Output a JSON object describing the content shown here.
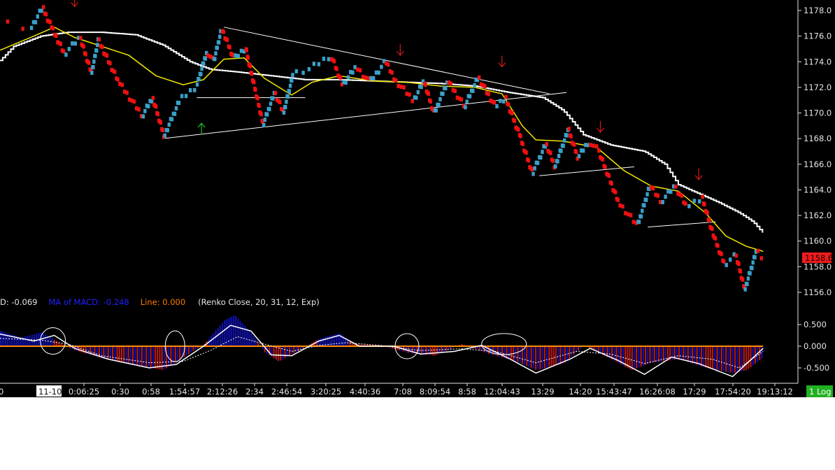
{
  "price_axis": {
    "ticks": [
      "1178.0",
      "1176.0",
      "1174.0",
      "1172.0",
      "1170.0",
      "1168.0",
      "1166.0",
      "1164.0",
      "1162.0",
      "1160.0",
      "1158.0",
      "1156.0"
    ],
    "current_price_label": "1158.6",
    "current_price_color": "#ee1c1c"
  },
  "macd_axis": {
    "ticks": [
      "0.500",
      "0.000",
      "-0.500"
    ]
  },
  "macd_header": {
    "macd_prefix": "D: ",
    "macd_value": "-0.069",
    "ma_label": "MA of MACD: ",
    "ma_value": "-0.248",
    "line_label": "Line: ",
    "line_value": "0.000",
    "params": "(Renko Close, 20, 31, 12, Exp)"
  },
  "time_axis": {
    "date_label": "11-10",
    "ticks": [
      "0:06:25",
      "0:30",
      "0:58",
      "1:54:57",
      "2:12:26",
      "2:34",
      "2:46:54",
      "3:20:25",
      "4:40:36",
      "7:08",
      "8:09:54",
      "8:58",
      "12:04:43",
      "13:29",
      "14:20",
      "15:43:47",
      "16:26:08",
      "17:29",
      "17:54:20",
      "19:13:12"
    ]
  },
  "log_button": {
    "label": "1 Log"
  },
  "colors": {
    "down_brick": "#ee1111",
    "up_brick": "#3aa0c8",
    "ma_fast": "#f2e600",
    "ma_slow": "#ffffff",
    "macd_positive": "#1010b0",
    "macd_negative": "#b01818",
    "signal_line": "#ff8a00",
    "arrow_down": "#d81818",
    "arrow_up": "#22bb22"
  },
  "chart_data": {
    "type": "line",
    "title": "",
    "y_range": [
      1155.2,
      1179.3
    ],
    "macd_range": [
      -0.72,
      0.62
    ],
    "price_path": [
      {
        "t": 0.0,
        "p": 1177.2
      },
      {
        "t": 0.045,
        "p": 1176.6
      },
      {
        "t": 0.063,
        "p": 1178.2
      },
      {
        "t": 0.075,
        "p": 1176.8
      },
      {
        "t": 0.095,
        "p": 1174.6
      },
      {
        "t": 0.118,
        "p": 1175.9
      },
      {
        "t": 0.135,
        "p": 1173.1
      },
      {
        "t": 0.145,
        "p": 1175.7
      },
      {
        "t": 0.175,
        "p": 1172.4
      },
      {
        "t": 0.21,
        "p": 1169.8
      },
      {
        "t": 0.225,
        "p": 1171.2
      },
      {
        "t": 0.242,
        "p": 1168.2
      },
      {
        "t": 0.265,
        "p": 1171.0
      },
      {
        "t": 0.29,
        "p": 1172.1
      },
      {
        "t": 0.305,
        "p": 1174.8
      },
      {
        "t": 0.315,
        "p": 1174.0
      },
      {
        "t": 0.327,
        "p": 1176.6
      },
      {
        "t": 0.345,
        "p": 1174.2
      },
      {
        "t": 0.362,
        "p": 1175.1
      },
      {
        "t": 0.388,
        "p": 1169.1
      },
      {
        "t": 0.405,
        "p": 1171.6
      },
      {
        "t": 0.418,
        "p": 1170.0
      },
      {
        "t": 0.432,
        "p": 1173.0
      },
      {
        "t": 0.452,
        "p": 1173.3
      },
      {
        "t": 0.488,
        "p": 1174.5
      },
      {
        "t": 0.505,
        "p": 1172.2
      },
      {
        "t": 0.525,
        "p": 1173.6
      },
      {
        "t": 0.545,
        "p": 1172.4
      },
      {
        "t": 0.568,
        "p": 1174.0
      },
      {
        "t": 0.585,
        "p": 1172.4
      },
      {
        "t": 0.61,
        "p": 1171.0
      },
      {
        "t": 0.625,
        "p": 1172.5
      },
      {
        "t": 0.64,
        "p": 1169.9
      },
      {
        "t": 0.66,
        "p": 1172.5
      },
      {
        "t": 0.685,
        "p": 1170.5
      },
      {
        "t": 0.705,
        "p": 1172.8
      },
      {
        "t": 0.73,
        "p": 1170.5
      },
      {
        "t": 0.745,
        "p": 1171.2
      },
      {
        "t": 0.765,
        "p": 1168.4
      },
      {
        "t": 0.785,
        "p": 1165.3
      },
      {
        "t": 0.805,
        "p": 1167.6
      },
      {
        "t": 0.818,
        "p": 1165.8
      },
      {
        "t": 0.838,
        "p": 1168.7
      },
      {
        "t": 0.852,
        "p": 1166.5
      },
      {
        "t": 0.868,
        "p": 1167.8
      },
      {
        "t": 0.882,
        "p": 1167.1
      },
      {
        "t": 0.912,
        "p": 1163.0
      },
      {
        "t": 0.94,
        "p": 1161.2
      },
      {
        "t": 0.958,
        "p": 1164.3
      },
      {
        "t": 0.975,
        "p": 1163.1
      },
      {
        "t": 0.995,
        "p": 1164.3
      },
      {
        "t": 1.012,
        "p": 1162.7
      },
      {
        "t": 1.035,
        "p": 1163.4
      },
      {
        "t": 1.052,
        "p": 1160.4
      },
      {
        "t": 1.068,
        "p": 1158.2
      },
      {
        "t": 1.085,
        "p": 1158.9
      },
      {
        "t": 1.098,
        "p": 1156.2
      },
      {
        "t": 1.115,
        "p": 1159.2
      },
      {
        "t": 1.125,
        "p": 1158.6
      }
    ],
    "ma_fast": [
      {
        "t": 0.0,
        "p": 1174.9
      },
      {
        "t": 0.05,
        "p": 1176.0
      },
      {
        "t": 0.08,
        "p": 1176.7
      },
      {
        "t": 0.11,
        "p": 1175.9
      },
      {
        "t": 0.15,
        "p": 1175.2
      },
      {
        "t": 0.19,
        "p": 1174.5
      },
      {
        "t": 0.23,
        "p": 1172.9
      },
      {
        "t": 0.27,
        "p": 1172.2
      },
      {
        "t": 0.3,
        "p": 1172.6
      },
      {
        "t": 0.33,
        "p": 1174.2
      },
      {
        "t": 0.36,
        "p": 1174.3
      },
      {
        "t": 0.39,
        "p": 1172.7
      },
      {
        "t": 0.43,
        "p": 1171.4
      },
      {
        "t": 0.46,
        "p": 1172.4
      },
      {
        "t": 0.5,
        "p": 1172.9
      },
      {
        "t": 0.55,
        "p": 1172.5
      },
      {
        "t": 0.6,
        "p": 1172.4
      },
      {
        "t": 0.65,
        "p": 1172.1
      },
      {
        "t": 0.7,
        "p": 1172.0
      },
      {
        "t": 0.74,
        "p": 1171.5
      },
      {
        "t": 0.77,
        "p": 1169.0
      },
      {
        "t": 0.79,
        "p": 1167.9
      },
      {
        "t": 0.83,
        "p": 1167.8
      },
      {
        "t": 0.88,
        "p": 1167.3
      },
      {
        "t": 0.92,
        "p": 1165.5
      },
      {
        "t": 0.96,
        "p": 1164.3
      },
      {
        "t": 1.0,
        "p": 1163.9
      },
      {
        "t": 1.04,
        "p": 1162.2
      },
      {
        "t": 1.07,
        "p": 1160.4
      },
      {
        "t": 1.1,
        "p": 1159.6
      },
      {
        "t": 1.125,
        "p": 1159.2
      }
    ],
    "ma_slow": [
      {
        "t": 0.0,
        "p": 1174.1
      },
      {
        "t": 0.02,
        "p": 1175.2
      },
      {
        "t": 0.06,
        "p": 1176.0
      },
      {
        "t": 0.1,
        "p": 1176.3
      },
      {
        "t": 0.15,
        "p": 1176.3
      },
      {
        "t": 0.2,
        "p": 1176.1
      },
      {
        "t": 0.24,
        "p": 1175.3
      },
      {
        "t": 0.28,
        "p": 1174.0
      },
      {
        "t": 0.31,
        "p": 1173.4
      },
      {
        "t": 0.35,
        "p": 1173.2
      },
      {
        "t": 0.4,
        "p": 1172.9
      },
      {
        "t": 0.45,
        "p": 1172.6
      },
      {
        "t": 0.5,
        "p": 1172.6
      },
      {
        "t": 0.55,
        "p": 1172.5
      },
      {
        "t": 0.6,
        "p": 1172.4
      },
      {
        "t": 0.65,
        "p": 1172.3
      },
      {
        "t": 0.7,
        "p": 1172.1
      },
      {
        "t": 0.75,
        "p": 1171.6
      },
      {
        "t": 0.8,
        "p": 1171.2
      },
      {
        "t": 0.83,
        "p": 1170.2
      },
      {
        "t": 0.86,
        "p": 1168.3
      },
      {
        "t": 0.9,
        "p": 1167.5
      },
      {
        "t": 0.95,
        "p": 1167.0
      },
      {
        "t": 0.98,
        "p": 1166.0
      },
      {
        "t": 1.0,
        "p": 1164.4
      },
      {
        "t": 1.03,
        "p": 1163.7
      },
      {
        "t": 1.06,
        "p": 1163.0
      },
      {
        "t": 1.09,
        "p": 1162.2
      },
      {
        "t": 1.11,
        "p": 1161.5
      },
      {
        "t": 1.125,
        "p": 1160.6
      }
    ],
    "trendlines": [
      {
        "t1": 0.33,
        "p1": 1176.7,
        "t2": 0.81,
        "p2": 1171.5
      },
      {
        "t1": 0.24,
        "p1": 1168.0,
        "t2": 0.835,
        "p2": 1171.6
      },
      {
        "t1": 0.29,
        "p1": 1171.2,
        "t2": 0.45,
        "p2": 1171.2
      },
      {
        "t1": 0.795,
        "p1": 1165.1,
        "t2": 0.935,
        "p2": 1165.8
      },
      {
        "t1": 0.955,
        "p1": 1161.1,
        "t2": 1.055,
        "p2": 1161.5
      }
    ],
    "signal_arrows": [
      {
        "type": "down",
        "t": 0.11,
        "p": 1178.3
      },
      {
        "type": "down",
        "t": 0.59,
        "p": 1174.5
      },
      {
        "type": "down",
        "t": 0.74,
        "p": 1173.6
      },
      {
        "type": "down",
        "t": 0.885,
        "p": 1168.5
      },
      {
        "type": "down",
        "t": 1.03,
        "p": 1164.8
      },
      {
        "type": "up",
        "t": 0.297,
        "p": 1169.2
      }
    ],
    "macd_hist": [
      {
        "t": 0.0,
        "v": 0.35
      },
      {
        "t": 0.03,
        "v": 0.2
      },
      {
        "t": 0.06,
        "v": 0.32
      },
      {
        "t": 0.09,
        "v": 0.05
      },
      {
        "t": 0.11,
        "v": -0.1
      },
      {
        "t": 0.15,
        "v": -0.28
      },
      {
        "t": 0.2,
        "v": -0.45
      },
      {
        "t": 0.24,
        "v": -0.55
      },
      {
        "t": 0.27,
        "v": -0.25
      },
      {
        "t": 0.3,
        "v": 0.05
      },
      {
        "t": 0.33,
        "v": 0.6
      },
      {
        "t": 0.345,
        "v": 0.72
      },
      {
        "t": 0.37,
        "v": 0.3
      },
      {
        "t": 0.39,
        "v": -0.15
      },
      {
        "t": 0.41,
        "v": -0.35
      },
      {
        "t": 0.44,
        "v": -0.1
      },
      {
        "t": 0.47,
        "v": 0.18
      },
      {
        "t": 0.5,
        "v": 0.3
      },
      {
        "t": 0.52,
        "v": 0.05
      },
      {
        "t": 0.56,
        "v": 0.02
      },
      {
        "t": 0.6,
        "v": -0.15
      },
      {
        "t": 0.64,
        "v": -0.22
      },
      {
        "t": 0.68,
        "v": 0.05
      },
      {
        "t": 0.72,
        "v": -0.18
      },
      {
        "t": 0.76,
        "v": -0.35
      },
      {
        "t": 0.79,
        "v": -0.55
      },
      {
        "t": 0.83,
        "v": -0.4
      },
      {
        "t": 0.86,
        "v": 0.02
      },
      {
        "t": 0.9,
        "v": -0.3
      },
      {
        "t": 0.93,
        "v": -0.55
      },
      {
        "t": 0.96,
        "v": -0.38
      },
      {
        "t": 1.0,
        "v": -0.3
      },
      {
        "t": 1.04,
        "v": -0.5
      },
      {
        "t": 1.08,
        "v": -0.62
      },
      {
        "t": 1.1,
        "v": -0.55
      },
      {
        "t": 1.125,
        "v": -0.25
      }
    ],
    "macd_line": [
      {
        "t": 0.0,
        "v": 0.28
      },
      {
        "t": 0.05,
        "v": 0.12
      },
      {
        "t": 0.08,
        "v": 0.25
      },
      {
        "t": 0.11,
        "v": -0.05
      },
      {
        "t": 0.16,
        "v": -0.3
      },
      {
        "t": 0.22,
        "v": -0.5
      },
      {
        "t": 0.26,
        "v": -0.42
      },
      {
        "t": 0.3,
        "v": 0.0
      },
      {
        "t": 0.34,
        "v": 0.48
      },
      {
        "t": 0.37,
        "v": 0.35
      },
      {
        "t": 0.4,
        "v": -0.2
      },
      {
        "t": 0.43,
        "v": -0.22
      },
      {
        "t": 0.47,
        "v": 0.12
      },
      {
        "t": 0.5,
        "v": 0.25
      },
      {
        "t": 0.53,
        "v": 0.0
      },
      {
        "t": 0.58,
        "v": 0.0
      },
      {
        "t": 0.62,
        "v": -0.18
      },
      {
        "t": 0.67,
        "v": -0.12
      },
      {
        "t": 0.71,
        "v": 0.02
      },
      {
        "t": 0.75,
        "v": -0.28
      },
      {
        "t": 0.79,
        "v": -0.62
      },
      {
        "t": 0.84,
        "v": -0.3
      },
      {
        "t": 0.87,
        "v": -0.05
      },
      {
        "t": 0.91,
        "v": -0.32
      },
      {
        "t": 0.95,
        "v": -0.65
      },
      {
        "t": 0.99,
        "v": -0.25
      },
      {
        "t": 1.03,
        "v": -0.4
      },
      {
        "t": 1.08,
        "v": -0.7
      },
      {
        "t": 1.125,
        "v": -0.05
      }
    ],
    "macd_ma": [
      {
        "t": 0.0,
        "v": 0.18
      },
      {
        "t": 0.06,
        "v": 0.14
      },
      {
        "t": 0.1,
        "v": 0.05
      },
      {
        "t": 0.15,
        "v": -0.22
      },
      {
        "t": 0.22,
        "v": -0.38
      },
      {
        "t": 0.27,
        "v": -0.35
      },
      {
        "t": 0.31,
        "v": -0.1
      },
      {
        "t": 0.35,
        "v": 0.22
      },
      {
        "t": 0.39,
        "v": 0.05
      },
      {
        "t": 0.43,
        "v": -0.12
      },
      {
        "t": 0.47,
        "v": 0.02
      },
      {
        "t": 0.51,
        "v": 0.08
      },
      {
        "t": 0.56,
        "v": 0.02
      },
      {
        "t": 0.62,
        "v": -0.1
      },
      {
        "t": 0.68,
        "v": -0.06
      },
      {
        "t": 0.73,
        "v": -0.12
      },
      {
        "t": 0.79,
        "v": -0.38
      },
      {
        "t": 0.85,
        "v": -0.12
      },
      {
        "t": 0.9,
        "v": -0.18
      },
      {
        "t": 0.95,
        "v": -0.4
      },
      {
        "t": 1.0,
        "v": -0.22
      },
      {
        "t": 1.05,
        "v": -0.3
      },
      {
        "t": 1.09,
        "v": -0.5
      },
      {
        "t": 1.125,
        "v": -0.12
      }
    ],
    "circled_crossovers": [
      {
        "t": 0.078,
        "v": 0.12
      },
      {
        "t": 0.258,
        "v": 0.0
      },
      {
        "t": 0.6,
        "v": 0.0
      },
      {
        "t": 0.743,
        "v": 0.05
      }
    ]
  }
}
